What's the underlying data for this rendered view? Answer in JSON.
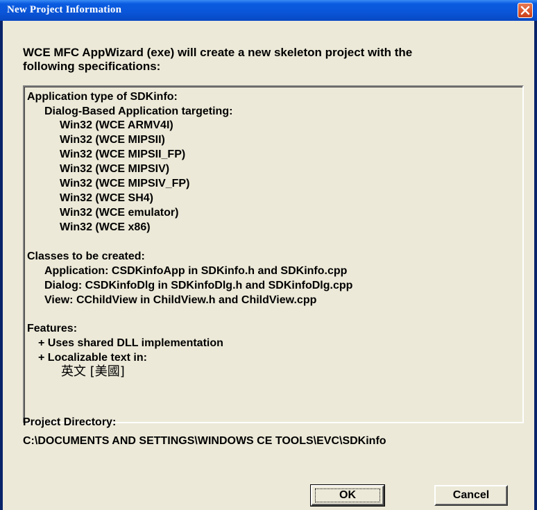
{
  "window": {
    "title": "New Project Information",
    "close_icon": "close-icon"
  },
  "intro": {
    "line1": "WCE MFC AppWizard (exe) will create a new skeleton project with the",
    "line2": "following specifications:"
  },
  "spec": {
    "app_type_heading": "Application type of SDKinfo:",
    "app_type_sub": "Dialog-Based Application targeting:",
    "platforms": [
      "Win32 (WCE ARMV4I)",
      "Win32 (WCE MIPSII)",
      "Win32 (WCE MIPSII_FP)",
      "Win32 (WCE MIPSIV)",
      "Win32 (WCE MIPSIV_FP)",
      "Win32 (WCE SH4)",
      "Win32 (WCE emulator)",
      "Win32 (WCE x86)"
    ],
    "classes_heading": "Classes to be created:",
    "classes": [
      "Application: CSDKinfoApp in SDKinfo.h and SDKinfo.cpp",
      "Dialog: CSDKinfoDlg in SDKinfoDlg.h and SDKinfoDlg.cpp",
      "View: CChildView in ChildView.h and ChildView.cpp"
    ],
    "features_heading": "Features:",
    "features": [
      "+ Uses shared DLL implementation",
      "+ Localizable text in:"
    ],
    "language": "英文 [美國]"
  },
  "project_dir": {
    "label": "Project Directory:",
    "path": "C:\\DOCUMENTS AND SETTINGS\\WINDOWS CE TOOLS\\EVC\\SDKinfo"
  },
  "buttons": {
    "ok": "OK",
    "cancel": "Cancel"
  },
  "colors": {
    "titlebar": "#0a55d8",
    "dialog_face": "#ece9d8",
    "close_button": "#d9532a"
  }
}
